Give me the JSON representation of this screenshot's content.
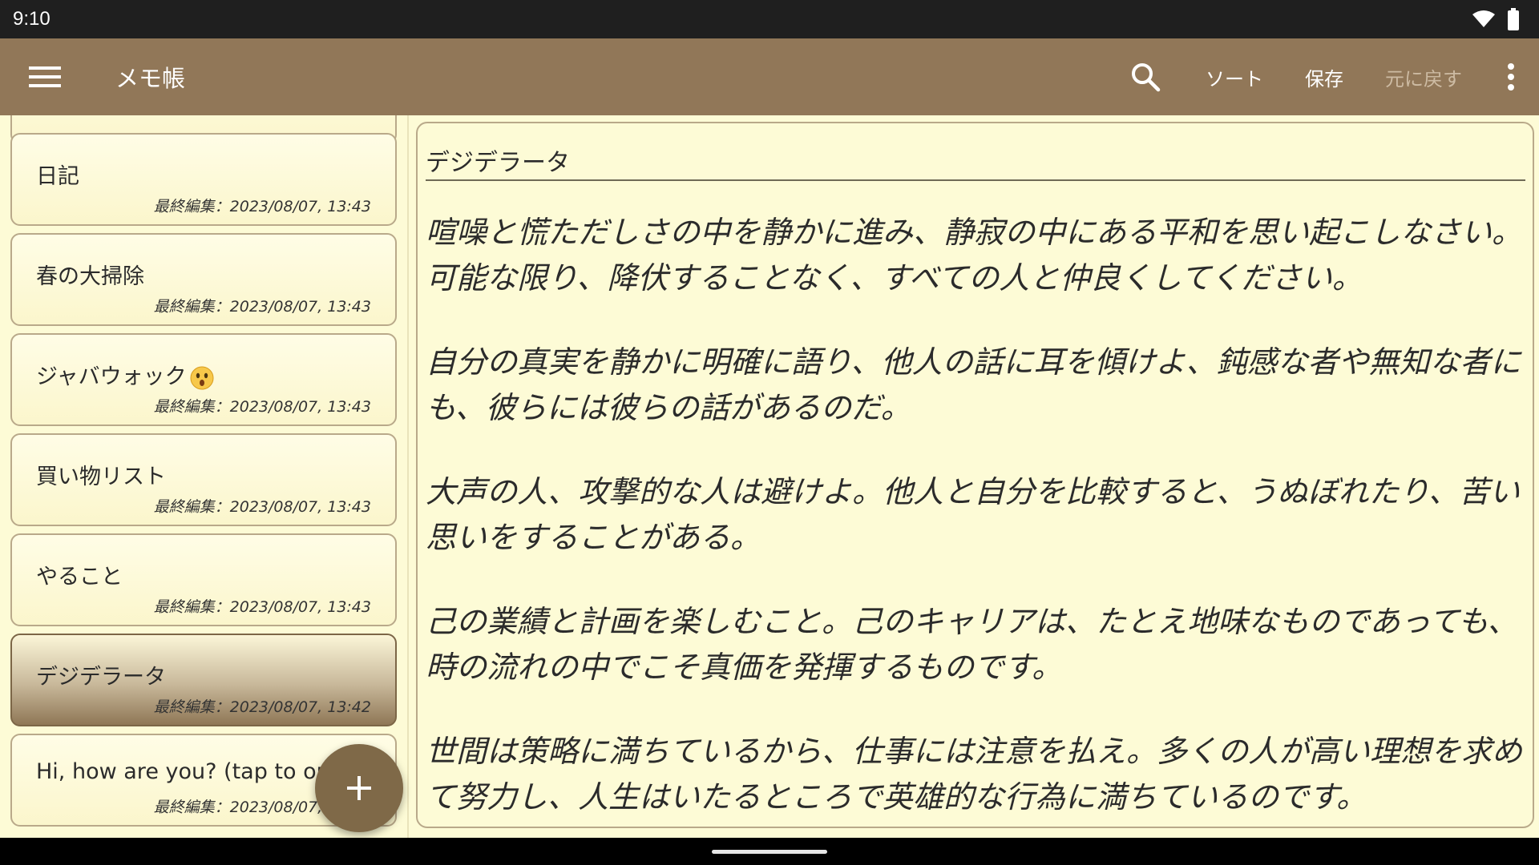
{
  "status_bar": {
    "time": "9:10",
    "wifi_icon": "wifi-icon",
    "battery_icon": "battery-icon"
  },
  "app_bar": {
    "title": "メモ帳",
    "menu_icon": "hamburger-menu-icon",
    "search_icon": "search-icon",
    "actions": {
      "sort": "ソート",
      "save": "保存",
      "undo": "元に戻す"
    },
    "overflow_icon": "more-vertical-icon",
    "color": "#917758"
  },
  "notes": [
    {
      "title": "",
      "date": ""
    },
    {
      "title": "日記",
      "date": "最終編集：2023/08/07, 13:43"
    },
    {
      "title": "春の大掃除",
      "date": "最終編集：2023/08/07, 13:43"
    },
    {
      "title": "ジャバウォック",
      "emoji": "astonished-face-icon",
      "date": "最終編集：2023/08/07, 13:43"
    },
    {
      "title": "買い物リスト",
      "date": "最終編集：2023/08/07, 13:43"
    },
    {
      "title": "やること",
      "date": "最終編集：2023/08/07, 13:43"
    },
    {
      "title": "デジデラータ",
      "date": "最終編集：2023/08/07, 13:42",
      "selected": true
    },
    {
      "title": "Hi, how are you? (tap to open)",
      "date": "最終編集：2023/08/07, 13:42"
    }
  ],
  "fab": {
    "icon": "plus-icon",
    "color": "#7f6948"
  },
  "editor": {
    "title": "デジデラータ",
    "paragraphs": [
      "喧噪と慌ただしさの中を静かに進み、静寂の中にある平和を思い起こしなさい。可能な限り、降伏することなく、すべての人と仲良くしてください。",
      "自分の真実を静かに明確に語り、他人の話に耳を傾けよ、鈍感な者や無知な者にも、彼らには彼らの話があるのだ。",
      "大声の人、攻撃的な人は避けよ。他人と自分を比較すると、うぬぼれたり、苦い思いをすることがある。",
      "己の業績と計画を楽しむこと。己のキャリアは、たとえ地味なものであっても、時の流れの中でこそ真価を発揮するものです。",
      "世間は策略に満ちているから、仕事には注意を払え。多くの人が高い理想を求めて努力し、人生はいたるところで英雄的な行為に満ちているのです。"
    ]
  }
}
